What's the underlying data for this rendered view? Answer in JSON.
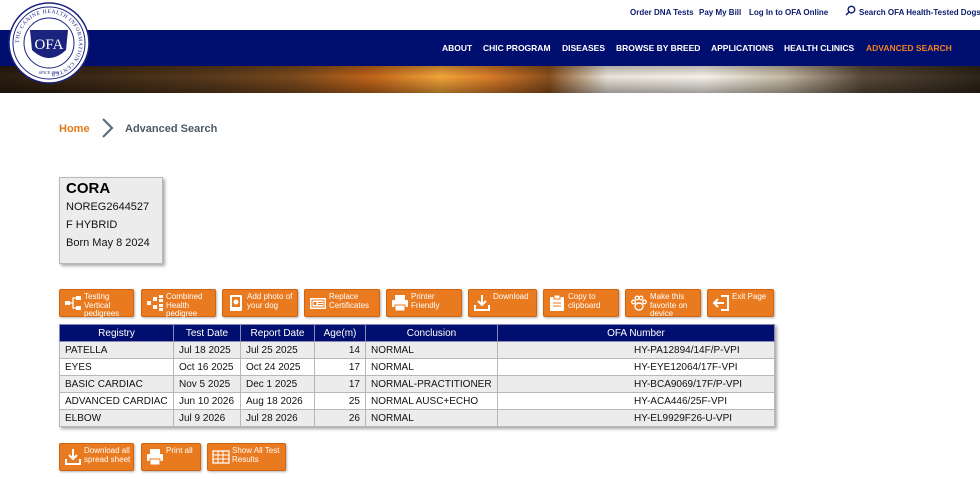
{
  "utility_links": {
    "order_dna": "Order DNA Tests",
    "pay_bill": "Pay My Bill",
    "login": "Log In to OFA Online",
    "search": "Search OFA Health-Tested Dogs"
  },
  "nav": {
    "about": "ABOUT",
    "chic": "CHIC PROGRAM",
    "diseases": "DISEASES",
    "browse": "BROWSE BY BREED",
    "applications": "APPLICATIONS",
    "clinics": "HEALTH CLINICS",
    "advanced": "ADVANCED SEARCH"
  },
  "logo": {
    "text": "OFA",
    "ring_text": "THE CANINE HEALTH INFORMATION CENTER",
    "since": "SINCE 1966"
  },
  "breadcrumb": {
    "home": "Home",
    "current": "Advanced Search"
  },
  "dog": {
    "name": "CORA",
    "registration": "NOREG2644527",
    "sex_breed": "F HYBRID",
    "born": "Born May 8 2024"
  },
  "actions": {
    "testing_vertical": "Testing Vertical pedigrees",
    "combined": "Combined Health pedigree",
    "add_photo": "Add photo of your dog",
    "replace_cert": "Replace Certificates",
    "printer": "Printer Friendly",
    "download": "Download",
    "copy": "Copy to clipboard",
    "favorite": "Make this favorite on device",
    "exit": "Exit Page",
    "download_all": "Download all spread sheet",
    "print_all": "Print all",
    "show_all": "Show All Test Results"
  },
  "table": {
    "headers": [
      "Registry",
      "Test Date",
      "Report Date",
      "Age(m)",
      "Conclusion",
      "OFA Number"
    ],
    "rows": [
      [
        "PATELLA",
        "Jul 18 2025",
        "Jul 25 2025",
        "14",
        "NORMAL",
        "HY-PA12894/14F/P-VPI"
      ],
      [
        "EYES",
        "Oct 16 2025",
        "Oct 24 2025",
        "17",
        "NORMAL",
        "HY-EYE12064/17F-VPI"
      ],
      [
        "BASIC CARDIAC",
        "Nov 5 2025",
        "Dec 1 2025",
        "17",
        "NORMAL-PRACTITIONER",
        "HY-BCA9069/17F/P-VPI"
      ],
      [
        "ADVANCED CARDIAC",
        "Jun 10 2026",
        "Aug 18 2026",
        "25",
        "NORMAL AUSC+ECHO",
        "HY-ACA446/25F-VPI"
      ],
      [
        "ELBOW",
        "Jul 9 2026",
        "Jul 28 2026",
        "26",
        "NORMAL",
        "HY-EL9929F26-U-VPI"
      ]
    ]
  },
  "colors": {
    "nav_bg": "#000f6f",
    "accent": "#ea7a1f",
    "link": "#0c1a6e"
  }
}
